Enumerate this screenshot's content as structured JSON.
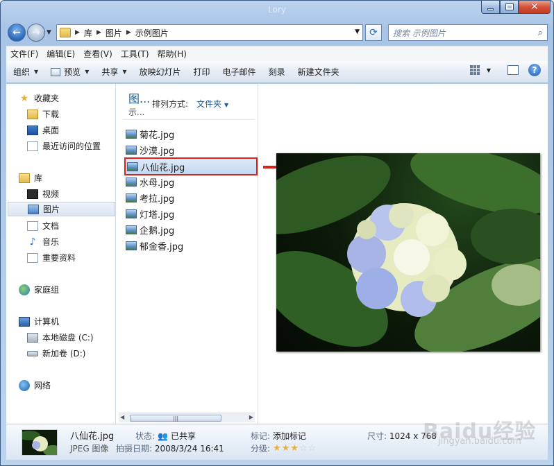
{
  "window": {
    "title": "Lory"
  },
  "address": {
    "crumbs": [
      "库",
      "图片",
      "示例图片"
    ]
  },
  "search": {
    "placeholder": "搜索 示例图片"
  },
  "menu": [
    "文件(F)",
    "编辑(E)",
    "查看(V)",
    "工具(T)",
    "帮助(H)"
  ],
  "toolbar": {
    "organize": "组织",
    "preview": "预览",
    "share": "共享",
    "slideshow": "放映幻灯片",
    "print": "打印",
    "email": "电子邮件",
    "burn": "刻录",
    "new_folder": "新建文件夹"
  },
  "nav": {
    "favorites": "收藏夹",
    "downloads": "下载",
    "desktop": "桌面",
    "recent": "最近访问的位置",
    "libraries": "库",
    "videos": "视频",
    "pictures": "图片",
    "documents": "文档",
    "music": "音乐",
    "important": "重要资料",
    "homegroup": "家庭组",
    "computer": "计算机",
    "local_disk": "本地磁盘 (C:)",
    "new_volume": "新加卷 (D:)",
    "network": "网络"
  },
  "library": {
    "title": "图...",
    "subtitle": "示...",
    "arrange_label": "排列方式:",
    "arrange_value": "文件夹"
  },
  "files": [
    "菊花.jpg",
    "沙漠.jpg",
    "八仙花.jpg",
    "水母.jpg",
    "考拉.jpg",
    "灯塔.jpg",
    "企鹅.jpg",
    "郁金香.jpg"
  ],
  "selected_file_index": 2,
  "details": {
    "filename": "八仙花.jpg",
    "type": "JPEG 图像",
    "status_label": "状态:",
    "status_value": "已共享",
    "date_label": "拍摄日期:",
    "date_value": "2008/3/24 16:41",
    "tag_label": "标记:",
    "tag_value": "添加标记",
    "rating_label": "分级:",
    "rating": 3,
    "rating_max": 5,
    "size_label": "尺寸:",
    "size_value": "1024 x 768"
  },
  "watermark": {
    "main": "Baidu经验",
    "sub": "jingyan.baidu.com"
  },
  "colors": {
    "selection_outline": "#d9221c",
    "link_blue": "#1f5b96"
  }
}
